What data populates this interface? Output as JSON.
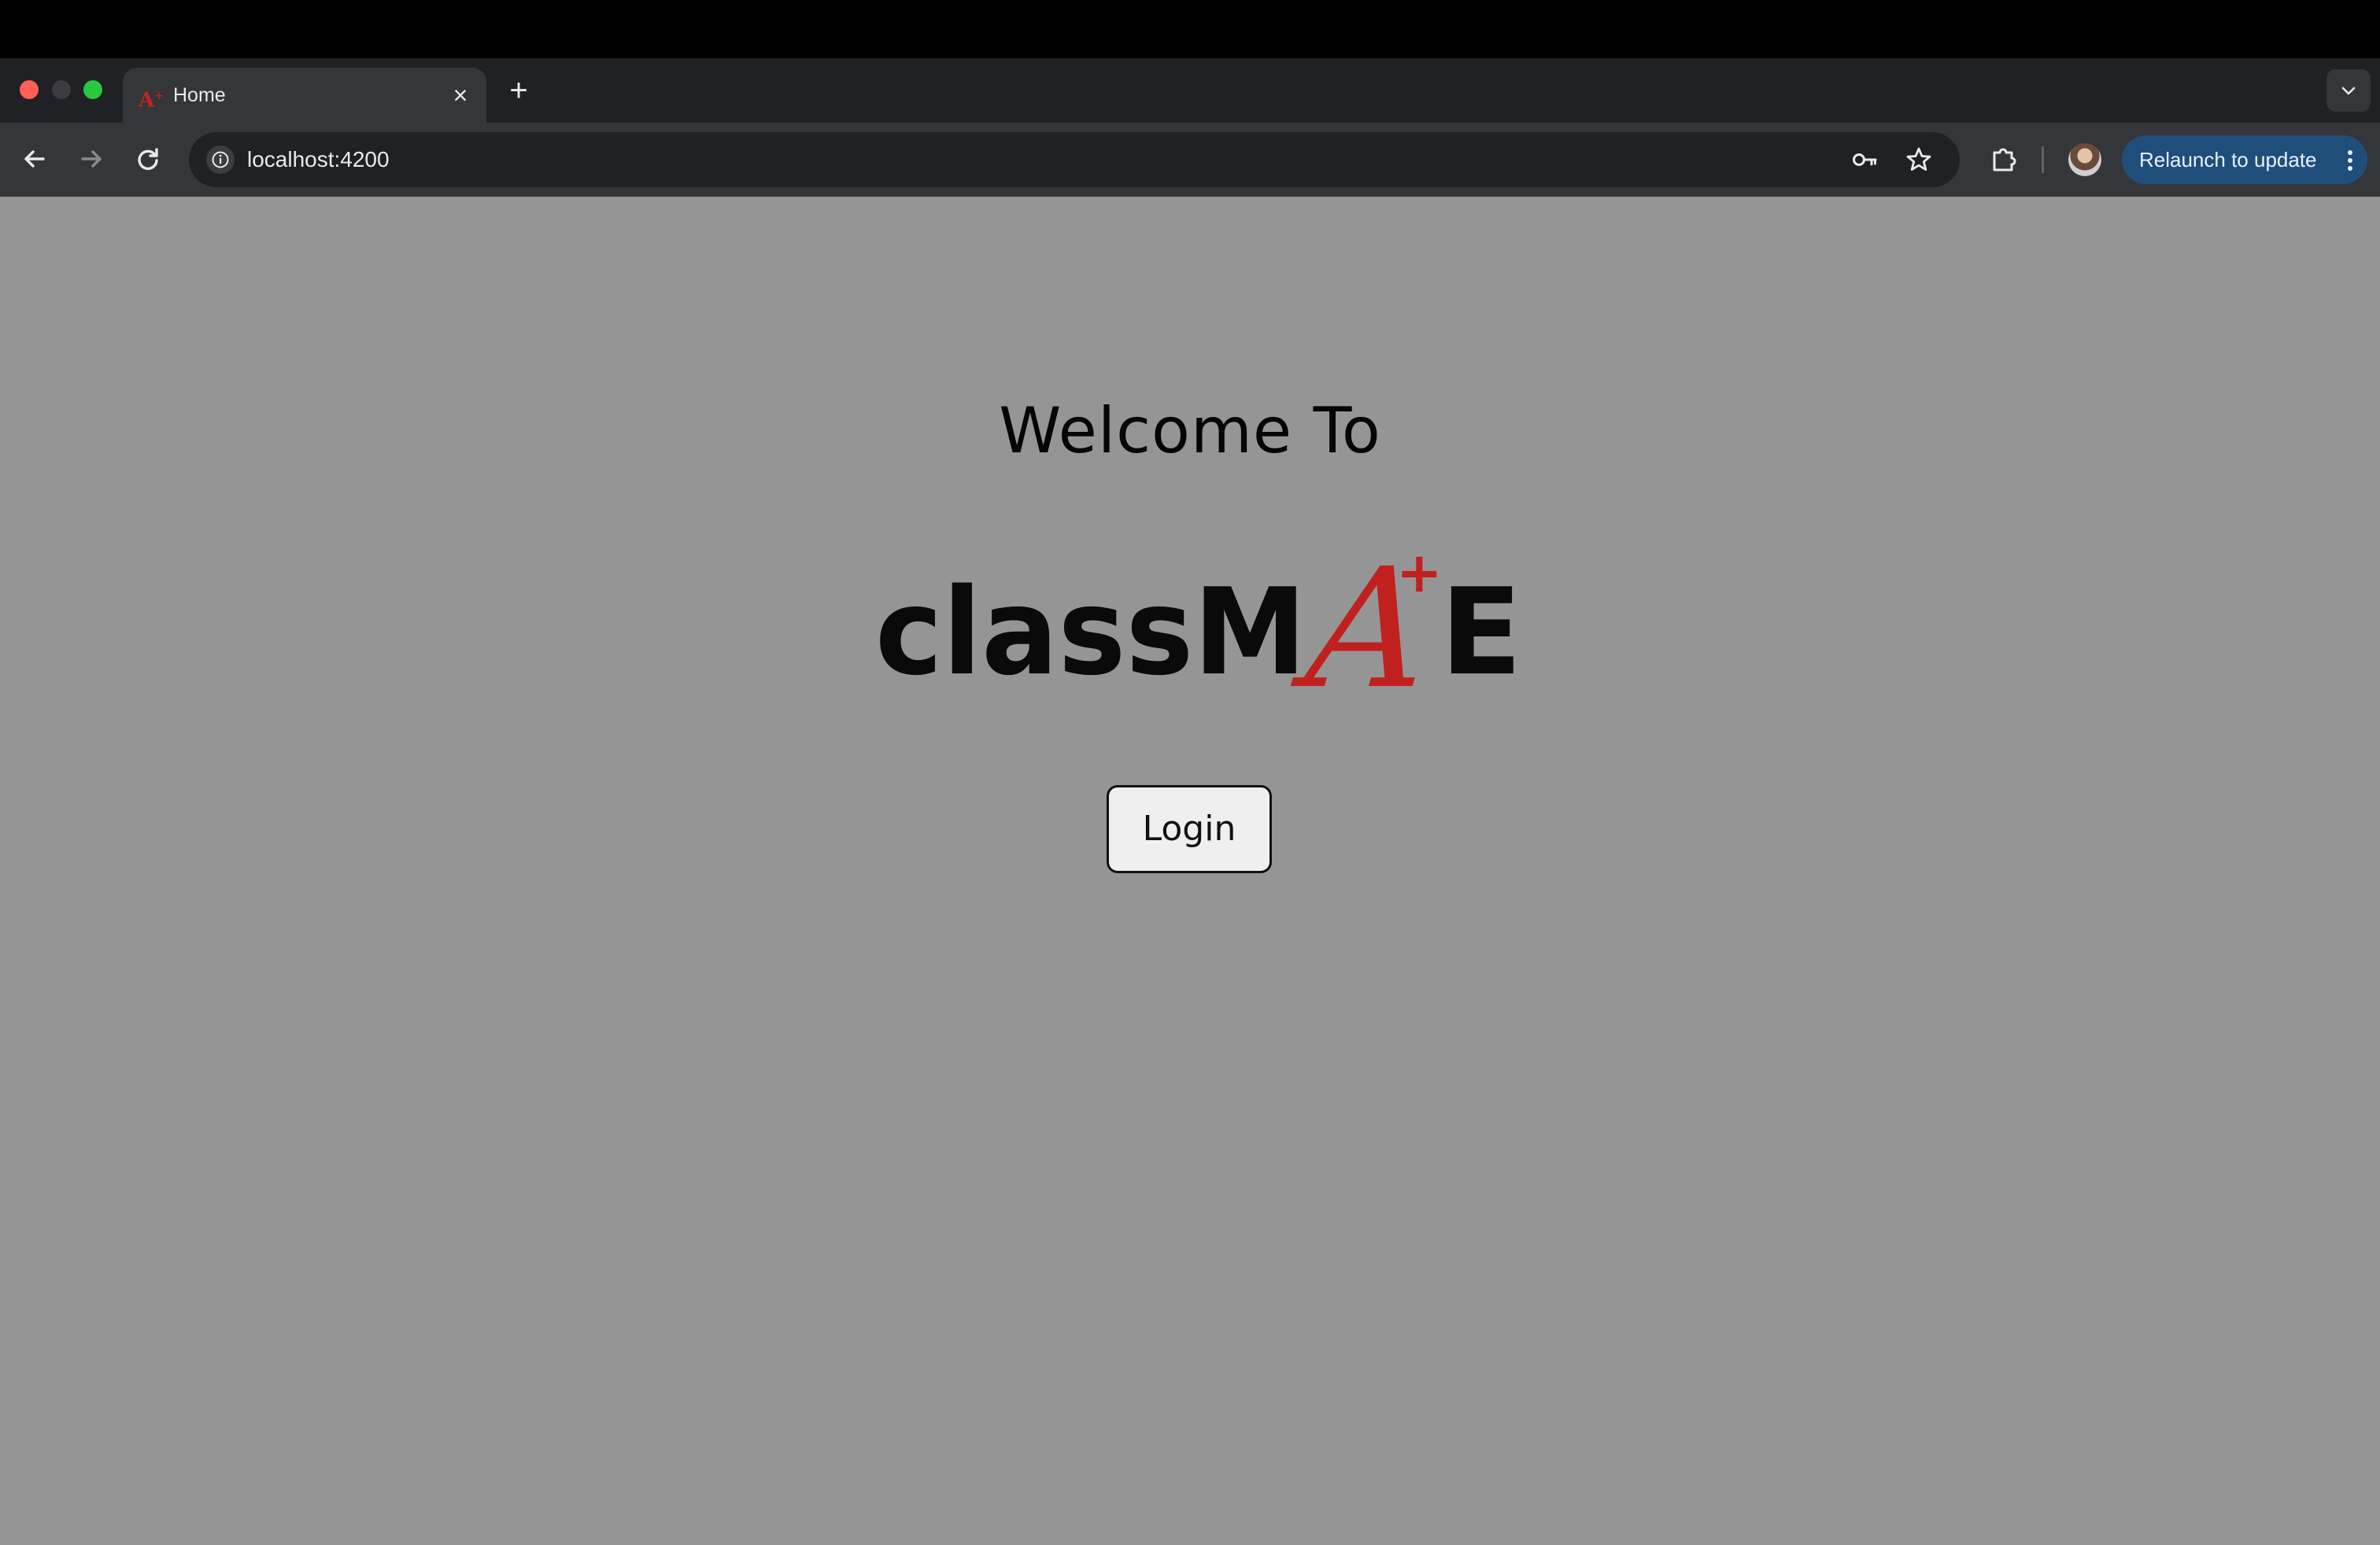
{
  "browser": {
    "tab": {
      "title": "Home",
      "favicon": "classmate-a-plus-icon",
      "close": "×"
    },
    "new_tab": "+",
    "address_bar": {
      "url": "localhost:4200"
    },
    "relaunch_button": "Relaunch to update",
    "icons": {
      "back": "back-arrow-icon",
      "forward": "forward-arrow-icon",
      "reload": "reload-icon",
      "site_info": "info-icon",
      "password_key": "key-icon",
      "bookmark": "star-icon",
      "extensions": "puzzle-icon",
      "profile": "avatar",
      "tab_search": "chevron-down-icon"
    }
  },
  "page": {
    "welcome_text": "Welcome To",
    "logo": {
      "wordmark_before": "classM",
      "wordmark_grade": "A",
      "wordmark_grade_mark": "+",
      "wordmark_after": "E"
    },
    "login_button": "Login"
  },
  "colors": {
    "page_background": "#959595",
    "logo_text": "#0a0a0a",
    "logo_accent": "#c0211f",
    "relaunch_button": "#1f4e7a",
    "toolbar": "#35363a",
    "tab_strip": "#202124"
  }
}
